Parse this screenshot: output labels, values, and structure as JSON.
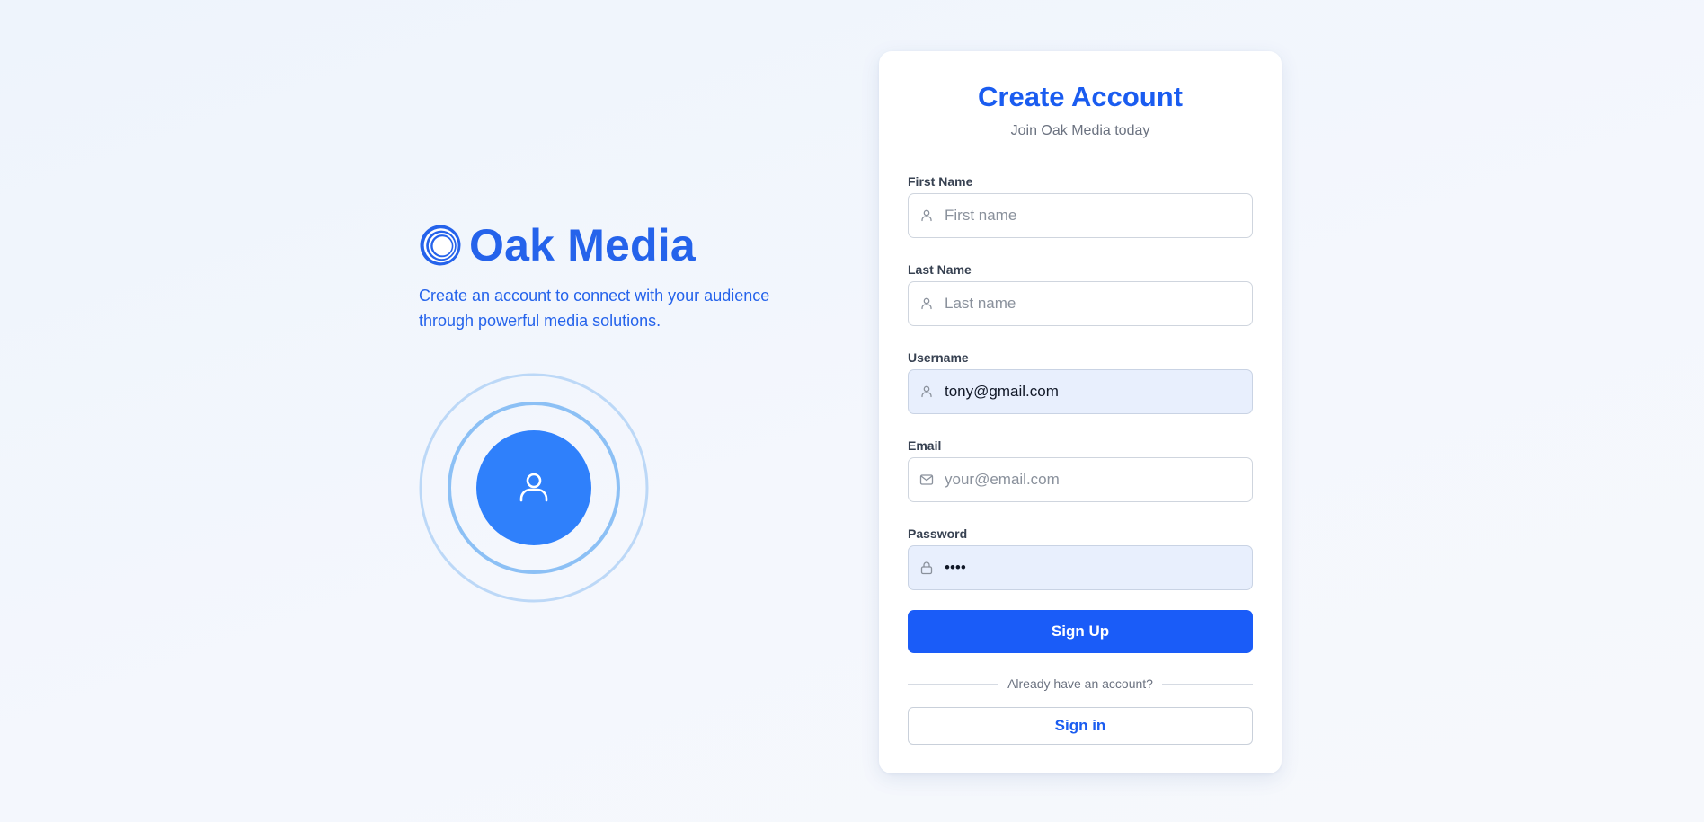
{
  "brand": {
    "name": "Oak Media",
    "tagline": "Create an account to connect with your audience through powerful media solutions.",
    "logo_icon": "concentric-circles-logo-icon",
    "illustration_icon": "user-icon"
  },
  "card": {
    "title": "Create Account",
    "subtitle": "Join Oak Media today"
  },
  "form": {
    "first_name": {
      "label": "First Name",
      "placeholder": "First name",
      "value": "",
      "icon": "user-icon"
    },
    "last_name": {
      "label": "Last Name",
      "placeholder": "Last name",
      "value": "",
      "icon": "user-icon"
    },
    "username": {
      "label": "Username",
      "placeholder": "",
      "value": "tony@gmail.com",
      "icon": "user-icon"
    },
    "email": {
      "label": "Email",
      "placeholder": "your@email.com",
      "value": "",
      "icon": "mail-icon"
    },
    "password": {
      "label": "Password",
      "placeholder": "",
      "value": "tony",
      "icon": "lock-icon"
    }
  },
  "actions": {
    "signup_label": "Sign Up",
    "divider_text": "Already have an account?",
    "signin_label": "Sign in"
  },
  "colors": {
    "accent": "#1a5cf8",
    "brand_text": "#2563eb",
    "autofill_bg": "#e8effd",
    "illustration_blue": "#2f80fb"
  }
}
